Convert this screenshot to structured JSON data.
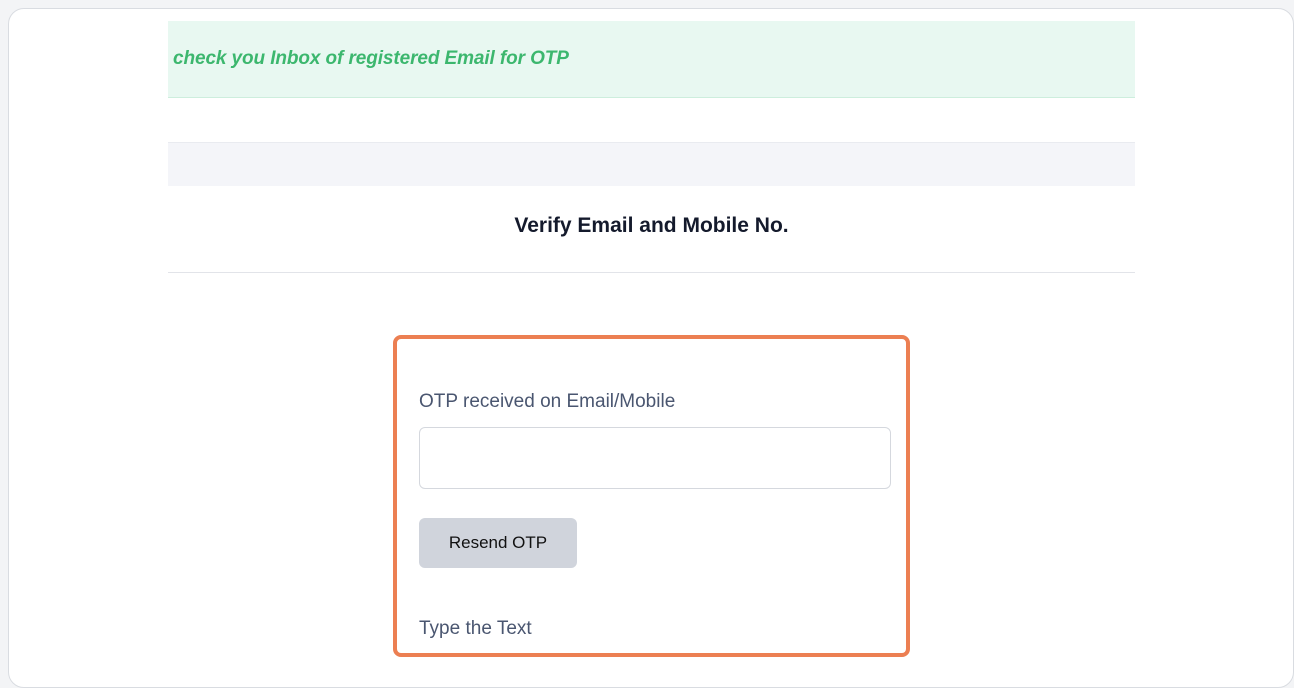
{
  "alert": {
    "message": "check you Inbox of registered Email for OTP"
  },
  "page": {
    "title": "Verify Email and Mobile No."
  },
  "otp_form": {
    "otp_label": "OTP received on Email/Mobile",
    "otp_value": "",
    "resend_label": "Resend OTP",
    "captcha_label": "Type the Text"
  },
  "colors": {
    "alert_bg": "#e8f8f1",
    "alert_text": "#3cb76e",
    "highlight_border": "#ec7f52",
    "button_bg": "#d0d4dc"
  }
}
